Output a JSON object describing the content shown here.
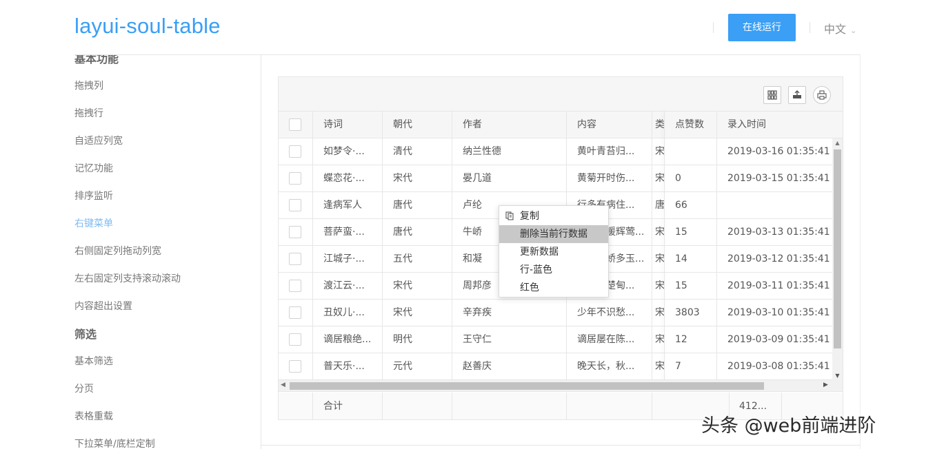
{
  "header": {
    "logo": "layui-soul-table",
    "run_button": "在线运行",
    "language": "中文"
  },
  "sidebar": {
    "top_partial": "基本功能",
    "items": [
      {
        "label": "拖拽列"
      },
      {
        "label": "拖拽行"
      },
      {
        "label": "自适应列宽"
      },
      {
        "label": "记忆功能"
      },
      {
        "label": "排序监听"
      },
      {
        "label": "右键菜单",
        "active": true
      },
      {
        "label": "右侧固定列拖动列宽"
      },
      {
        "label": "左右固定列支持滚动滚动"
      },
      {
        "label": "内容超出设置"
      }
    ],
    "group2": "筛选",
    "items2": [
      {
        "label": "基本筛选"
      },
      {
        "label": "分页"
      },
      {
        "label": "表格重载"
      },
      {
        "label": "下拉菜单/底栏定制"
      }
    ]
  },
  "table": {
    "toolbar_icons": [
      "columns-icon",
      "export-icon",
      "print-icon"
    ],
    "columns": [
      "诗词",
      "朝代",
      "作者",
      "内容",
      "类型",
      "点赞数",
      "录入时间"
    ],
    "rows": [
      {
        "poem": "如梦令·...",
        "dynasty": "清代",
        "author": "纳兰性德",
        "content": "黄叶青苔归...",
        "type": "宋",
        "likes": "",
        "time": "2019-03-16 01:35:41"
      },
      {
        "poem": "蝶恋花·...",
        "dynasty": "宋代",
        "author": "晏几道",
        "content": "黄菊开时伤...",
        "type": "宋",
        "likes": "0",
        "time": "2019-03-15 01:35:41"
      },
      {
        "poem": "逢病军人",
        "dynasty": "唐代",
        "author": "卢纶",
        "content": "行多有病住...",
        "type": "唐",
        "likes": "66",
        "time": ""
      },
      {
        "poem": "菩萨蛮·...",
        "dynasty": "唐代",
        "author": "牛峤",
        "content": "舞裙香暖辉莺...",
        "type": "宋",
        "likes": "15",
        "time": "2019-03-13 01:35:41"
      },
      {
        "poem": "江城子·...",
        "dynasty": "五代",
        "author": "和凝",
        "content": "初夜含娇多玉...",
        "type": "宋",
        "likes": "14",
        "time": "2019-03-12 01:35:41"
      },
      {
        "poem": "渡江云·...",
        "dynasty": "宋代",
        "author": "周邦彦",
        "content": "晴岚低楚甸...",
        "type": "宋",
        "likes": "15",
        "time": "2019-03-11 01:35:41"
      },
      {
        "poem": "丑奴儿·...",
        "dynasty": "宋代",
        "author": "辛弃疾",
        "content": "少年不识愁...",
        "type": "宋",
        "likes": "3803",
        "time": "2019-03-10 01:35:41"
      },
      {
        "poem": "谪居粮绝...",
        "dynasty": "明代",
        "author": "王守仁",
        "content": "谪居屡在陈...",
        "type": "宋",
        "likes": "12",
        "time": "2019-03-09 01:35:41"
      },
      {
        "poem": "普天乐·...",
        "dynasty": "元代",
        "author": "赵善庆",
        "content": "晚天长，秋...",
        "type": "宋",
        "likes": "7",
        "time": "2019-03-08 01:35:41"
      }
    ],
    "footer": {
      "label": "合计",
      "sum": "412..."
    }
  },
  "context_menu": {
    "items": [
      {
        "label": "复制",
        "icon": "copy-icon"
      },
      {
        "label": "删除当前行数据",
        "hover": true
      },
      {
        "label": "更新数据"
      },
      {
        "label": "行-蓝色"
      },
      {
        "label": "红色"
      }
    ]
  },
  "watermark": "头条 @web前端进阶"
}
